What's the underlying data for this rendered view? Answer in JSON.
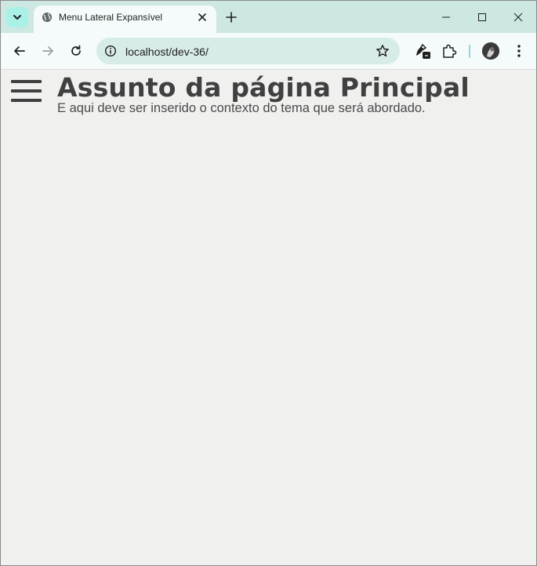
{
  "browser": {
    "tab": {
      "title": "Menu Lateral Expansível"
    },
    "address_bar": {
      "url": "localhost/dev-36/"
    },
    "colors": {
      "tabstrip": "#cde8e3",
      "toolbar": "#f4fbfa",
      "omnibox": "#d7ebe7"
    }
  },
  "page": {
    "title": "Assunto da página Principal",
    "subtitle": "E aqui deve ser inserido o contexto do tema que será abordado.",
    "menu_icon": "hamburger-menu-icon",
    "background": "#f0f0ef"
  }
}
